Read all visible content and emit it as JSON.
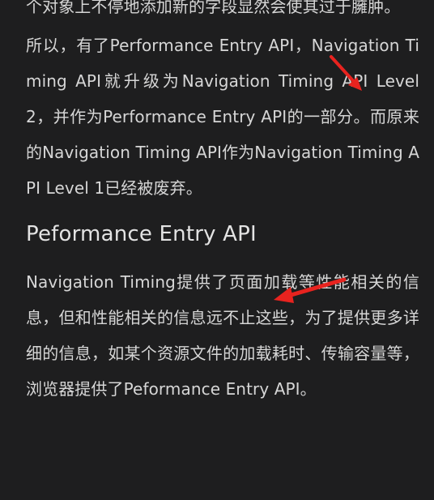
{
  "article": {
    "intro_paragraph": "个对象上不停地添加新的字段显然会使其过于臃肿。",
    "paragraph_2": "所以，有了Performance Entry API，Navigation Timing API就升级为Navigation Timing API Level 2，并作为Performance Entry API的一部分。而原来的Navigation Timing API作为Navigation Timing API Level 1已经被废弃。",
    "section_heading": "Peformance Entry API",
    "paragraph_3": "Navigation Timing提供了页面加载等性能相关的信息，但和性能相关的信息远不止这些，为了提供更多详细的信息，如某个资源文件的加载耗时、传输容量等，浏览器提供了Peformance Entry API。"
  },
  "colors": {
    "background": "#1e1e1f",
    "text": "#d6d6d6",
    "annotation_arrow": "#e8231f"
  },
  "icons": [
    "annotation-arrow-icon",
    "annotation-arrow-icon"
  ]
}
